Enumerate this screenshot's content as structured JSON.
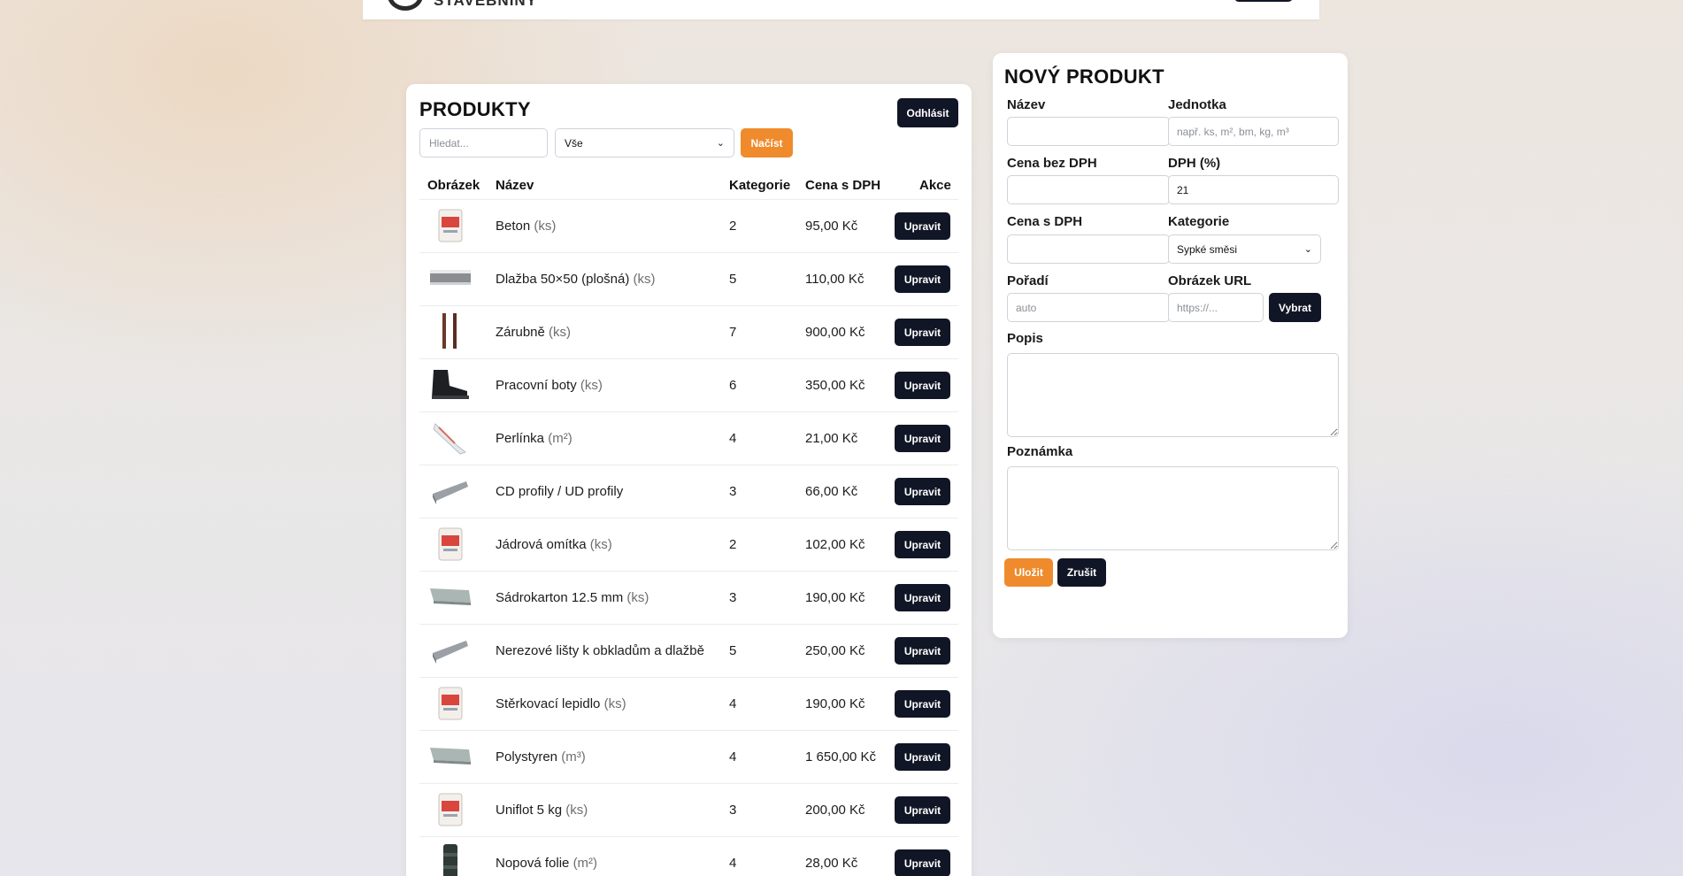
{
  "header": {
    "logo_text": "STAVEBNINY"
  },
  "products": {
    "title": "PRODUKTY",
    "logout_label": "Odhlásit",
    "search_placeholder": "Hledat...",
    "category_filter_value": "Vše",
    "load_label": "Načíst",
    "columns": [
      "Obrázek",
      "Název",
      "Kategorie",
      "Cena s DPH",
      "Akce"
    ],
    "edit_label": "Upravit",
    "rows": [
      {
        "name": "Beton",
        "unit": "(ks)",
        "category": "2",
        "price": "95,00 Kč",
        "image": "bag-icon"
      },
      {
        "name": "Dlažba 50×50 (plošná)",
        "unit": "(ks)",
        "category": "5",
        "price": "110,00 Kč",
        "image": "tile-icon"
      },
      {
        "name": "Zárubně",
        "unit": "(ks)",
        "category": "7",
        "price": "900,00 Kč",
        "image": "door-frame-icon"
      },
      {
        "name": "Pracovní boty",
        "unit": "(ks)",
        "category": "6",
        "price": "350,00 Kč",
        "image": "boot-icon"
      },
      {
        "name": "Perlínka",
        "unit": "(m²)",
        "category": "4",
        "price": "21,00 Kč",
        "image": "mesh-roll-icon"
      },
      {
        "name": "CD profily / UD profily",
        "unit": "",
        "category": "3",
        "price": "66,00 Kč",
        "image": "profile-icon"
      },
      {
        "name": "Jádrová omítka",
        "unit": "(ks)",
        "category": "2",
        "price": "102,00 Kč",
        "image": "bag-icon"
      },
      {
        "name": "Sádrokarton 12.5 mm",
        "unit": "(ks)",
        "category": "3",
        "price": "190,00 Kč",
        "image": "board-icon"
      },
      {
        "name": "Nerezové lišty k obkladům a dlažbě",
        "unit": "",
        "category": "5",
        "price": "250,00 Kč",
        "image": "profile-icon"
      },
      {
        "name": "Stěrkovací lepidlo",
        "unit": "(ks)",
        "category": "4",
        "price": "190,00 Kč",
        "image": "bag-icon"
      },
      {
        "name": "Polystyren",
        "unit": "(m³)",
        "category": "4",
        "price": "1 650,00 Kč",
        "image": "board-icon"
      },
      {
        "name": "Uniflot 5 kg",
        "unit": "(ks)",
        "category": "3",
        "price": "200,00 Kč",
        "image": "bag-icon"
      },
      {
        "name": "Nopová folie",
        "unit": "(m²)",
        "category": "4",
        "price": "28,00 Kč",
        "image": "roll-icon"
      }
    ]
  },
  "new_product": {
    "title": "NOVÝ PRODUKT",
    "name_label": "Název",
    "name_value": "",
    "unit_label": "Jednotka",
    "unit_placeholder": "např. ks, m², bm, kg, m³",
    "price_net_label": "Cena bez DPH",
    "price_net_value": "",
    "vat_label": "DPH (%)",
    "vat_value": "21",
    "price_gross_label": "Cena s DPH",
    "price_gross_value": "",
    "category_label": "Kategorie",
    "category_value": "Sypké směsi",
    "order_label": "Pořadí",
    "order_placeholder": "auto",
    "image_url_label": "Obrázek URL",
    "image_url_placeholder": "https://...",
    "choose_label": "Vybrat",
    "description_label": "Popis",
    "note_label": "Poznámka",
    "save_label": "Uložit",
    "cancel_label": "Zrušit"
  },
  "colors": {
    "accent_orange": "#ef8b2c",
    "dark_button": "#111626"
  }
}
